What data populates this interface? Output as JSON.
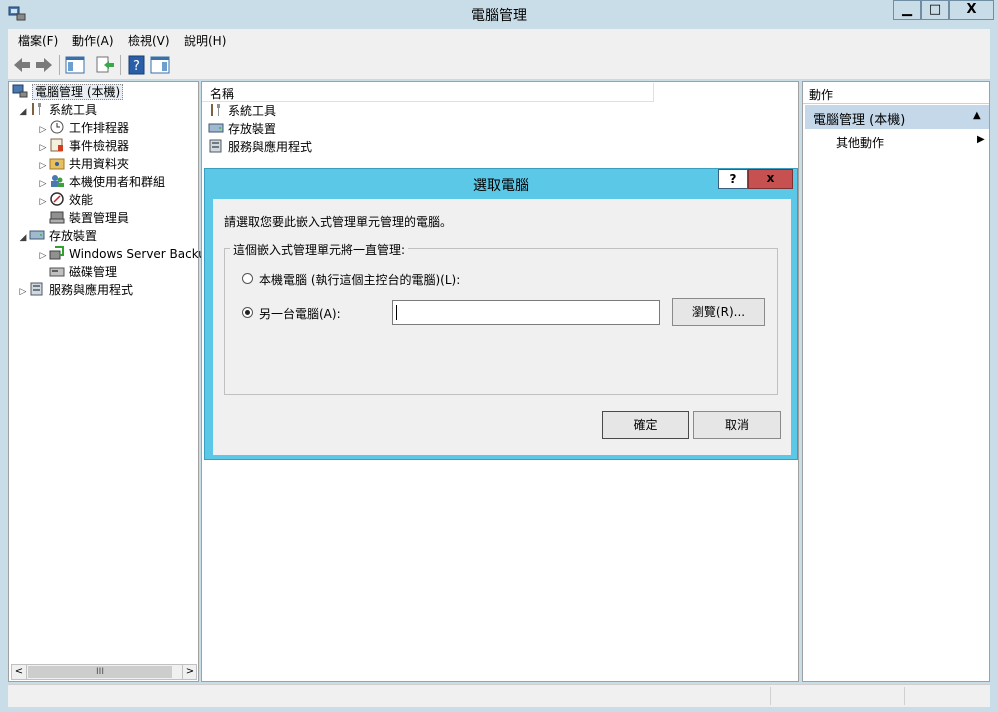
{
  "window": {
    "title": "電腦管理",
    "min_label": "▁",
    "max_label": "□",
    "close_label": "X"
  },
  "menu": [
    "檔案(F)",
    "動作(A)",
    "檢視(V)",
    "說明(H)"
  ],
  "tree": {
    "root": "電腦管理 (本機)",
    "items": [
      {
        "label": "系統工具",
        "level": 1,
        "expand": "◢"
      },
      {
        "label": "工作排程器",
        "level": 2,
        "expand": "▷"
      },
      {
        "label": "事件檢視器",
        "level": 2,
        "expand": "▷"
      },
      {
        "label": "共用資料夾",
        "level": 2,
        "expand": "▷"
      },
      {
        "label": "本機使用者和群組",
        "level": 2,
        "expand": "▷"
      },
      {
        "label": "效能",
        "level": 2,
        "expand": "▷"
      },
      {
        "label": "裝置管理員",
        "level": 2,
        "expand": ""
      },
      {
        "label": "存放裝置",
        "level": 1,
        "expand": "◢"
      },
      {
        "label": "Windows Server Backup",
        "level": 2,
        "expand": "▷"
      },
      {
        "label": "磁碟管理",
        "level": 2,
        "expand": ""
      },
      {
        "label": "服務與應用程式",
        "level": 1,
        "expand": "▷"
      }
    ]
  },
  "list": {
    "header": "名稱",
    "items": [
      "系統工具",
      "存放裝置",
      "服務與應用程式"
    ]
  },
  "actions": {
    "header": "動作",
    "section": "電腦管理 (本機)",
    "more": "其他動作"
  },
  "dialog": {
    "title": "選取電腦",
    "help_label": "?",
    "close_label": "x",
    "instruction": "請選取您要此嵌入式管理單元管理的電腦。",
    "group_label": "這個嵌入式管理單元將一直管理:",
    "option_local": "本機電腦 (執行這個主控台的電腦)(L):",
    "option_other": "另一台電腦(A):",
    "computer_value": "",
    "browse_label": "瀏覽(R)...",
    "ok_label": "確定",
    "cancel_label": "取消",
    "selected_option": "other"
  },
  "scrollbar": {
    "left": "<",
    "right": ">",
    "thumb": "III"
  }
}
